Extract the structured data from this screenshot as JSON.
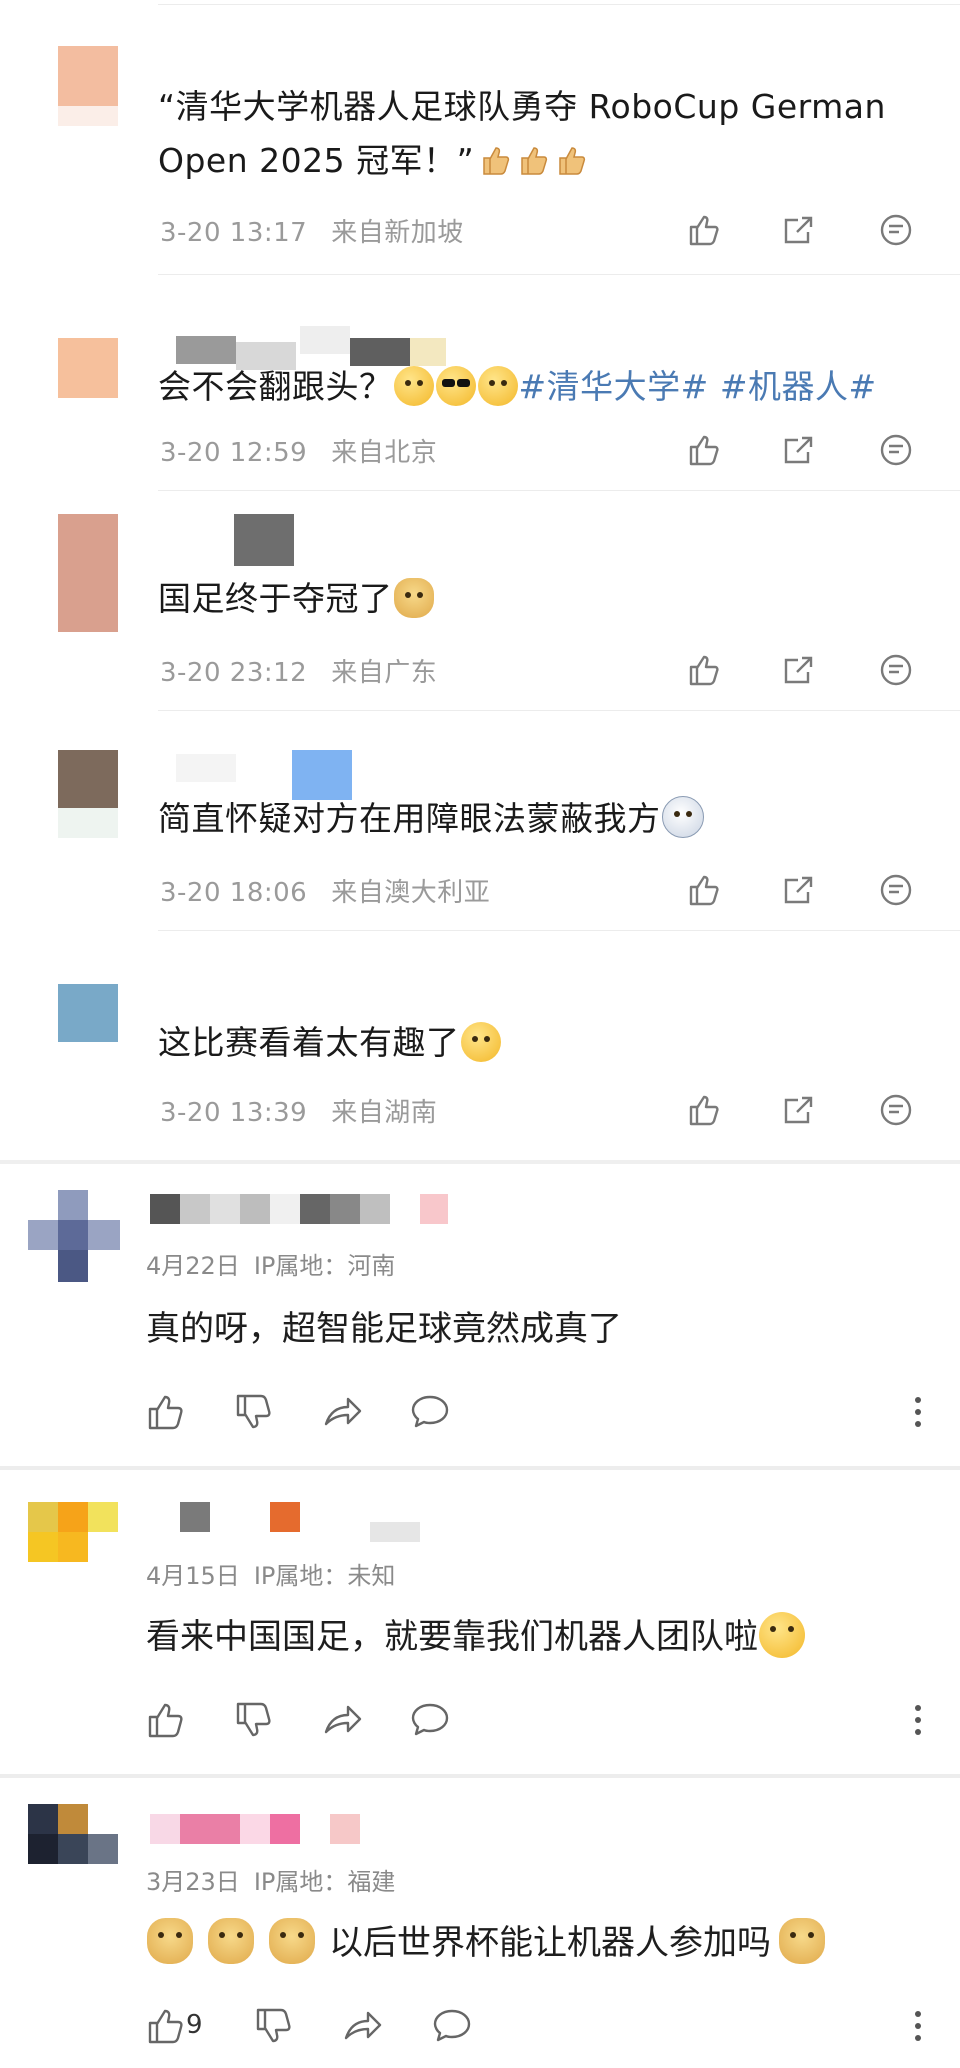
{
  "weibo": {
    "comments": [
      {
        "text_before": "“清华大学机器人足球队勇夺 RoboCup German Open 2025 冠军！”",
        "emojis": [
          "thumbs-up-icon",
          "thumbs-up-icon",
          "thumbs-up-icon"
        ],
        "time": "3-20 13:17",
        "location": "来自新加坡"
      },
      {
        "text_before": "会不会翻跟头？",
        "emojis": [
          "shush-emoji",
          "cool-emoji",
          "laugh-emoji"
        ],
        "hashtags": [
          "#清华大学#",
          "#机器人#"
        ],
        "time": "3-20 12:59",
        "location": "来自北京"
      },
      {
        "text_before": "国足终于夺冠了",
        "emojis": [
          "doge-emoji"
        ],
        "time": "3-20 23:12",
        "location": "来自广东"
      },
      {
        "text_before": "简直怀疑对方在用障眼法蒙蔽我方",
        "emojis": [
          "husky-emoji"
        ],
        "time": "3-20 18:06",
        "location": "来自澳大利亚"
      },
      {
        "text_before": "这比赛看着太有趣了",
        "emojis": [
          "smile-emoji"
        ],
        "time": "3-20 13:39",
        "location": "来自湖南"
      }
    ],
    "action_icons": [
      "like-icon",
      "repost-icon",
      "comment-icon"
    ]
  },
  "baidu": {
    "comments": [
      {
        "date": "4月22日",
        "ip": "IP属地：河南",
        "text": "真的呀，超智能足球竟然成真了",
        "like_count": ""
      },
      {
        "date": "4月15日",
        "ip": "IP属地：未知",
        "text": "看来中国国足，就要靠我们机器人团队啦",
        "like_count": ""
      },
      {
        "date": "3月23日",
        "ip": "IP属地：福建",
        "text": "以后世界杯能让机器人参加吗",
        "like_count": "9"
      }
    ],
    "action_icons": [
      "thumbs-up-icon",
      "thumbs-down-icon",
      "share-icon",
      "reply-icon",
      "more-icon"
    ]
  },
  "colors": {
    "hashtag": "#4a7ab3",
    "meta_gray": "#9a9a9a",
    "icon_gray": "#7a7a7a"
  }
}
